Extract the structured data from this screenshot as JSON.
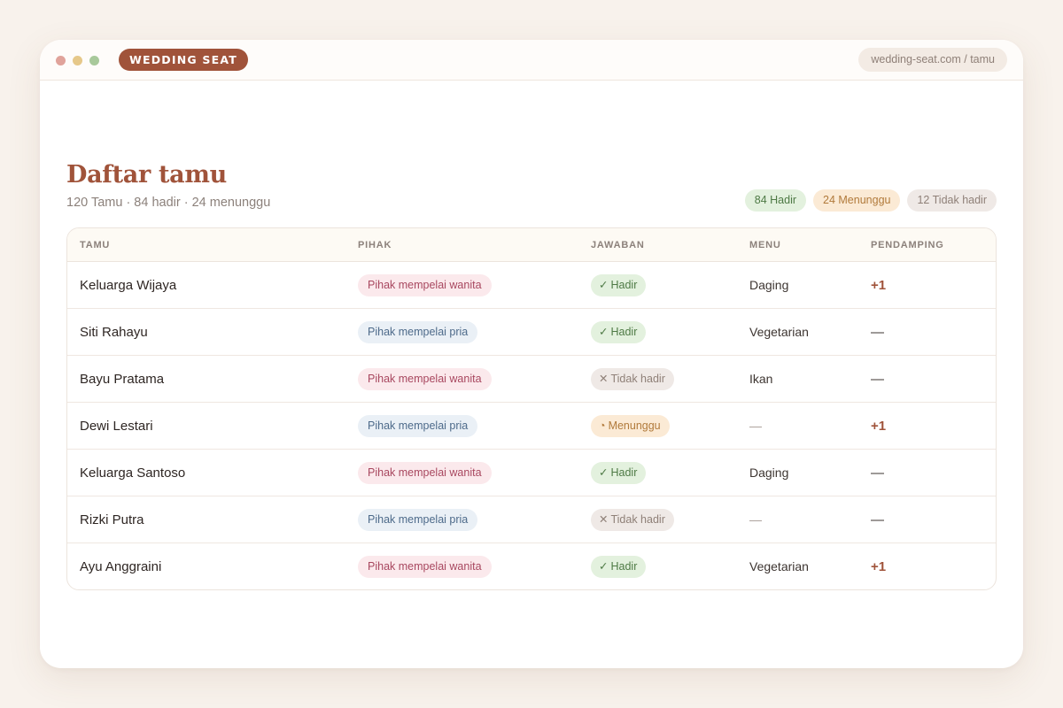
{
  "window": {
    "brand": "WEDDING SEAT",
    "url": "wedding-seat.com / tamu"
  },
  "header": {
    "title": "Daftar tamu",
    "subtitle": "120 Tamu · 84 hadir · 24 menunggu",
    "summary": [
      {
        "label": "84 Hadir",
        "kind": "hadir"
      },
      {
        "label": "24 Menunggu",
        "kind": "wait"
      },
      {
        "label": "12 Tidak hadir",
        "kind": "no"
      }
    ]
  },
  "table": {
    "columns": [
      "TAMU",
      "PIHAK",
      "JAWABAN",
      "MENU",
      "PENDAMPING"
    ],
    "rows": [
      {
        "name": "Keluarga Wijaya",
        "side": "Pihak mempelai wanita",
        "side_kind": "wanita",
        "status_icon": "✓",
        "status": "Hadir",
        "status_kind": "hadir",
        "menu": "Daging",
        "companion": "+1"
      },
      {
        "name": "Siti Rahayu",
        "side": "Pihak mempelai pria",
        "side_kind": "pria",
        "status_icon": "✓",
        "status": "Hadir",
        "status_kind": "hadir",
        "menu": "Vegetarian",
        "companion": "—"
      },
      {
        "name": "Bayu Pratama",
        "side": "Pihak mempelai wanita",
        "side_kind": "wanita",
        "status_icon": "✕",
        "status": "Tidak hadir",
        "status_kind": "tidak",
        "menu": "Ikan",
        "companion": "—"
      },
      {
        "name": "Dewi Lestari",
        "side": "Pihak mempelai pria",
        "side_kind": "pria",
        "status_icon": "◔",
        "status": "Menunggu",
        "status_kind": "menunggu",
        "menu": "—",
        "companion": "+1"
      },
      {
        "name": "Keluarga Santoso",
        "side": "Pihak mempelai wanita",
        "side_kind": "wanita",
        "status_icon": "✓",
        "status": "Hadir",
        "status_kind": "hadir",
        "menu": "Daging",
        "companion": "—"
      },
      {
        "name": "Rizki Putra",
        "side": "Pihak mempelai pria",
        "side_kind": "pria",
        "status_icon": "✕",
        "status": "Tidak hadir",
        "status_kind": "tidak",
        "menu": "—",
        "companion": "—"
      },
      {
        "name": "Ayu Anggraini",
        "side": "Pihak mempelai wanita",
        "side_kind": "wanita",
        "status_icon": "✓",
        "status": "Hadir",
        "status_kind": "hadir",
        "menu": "Vegetarian",
        "companion": "+1"
      }
    ]
  }
}
